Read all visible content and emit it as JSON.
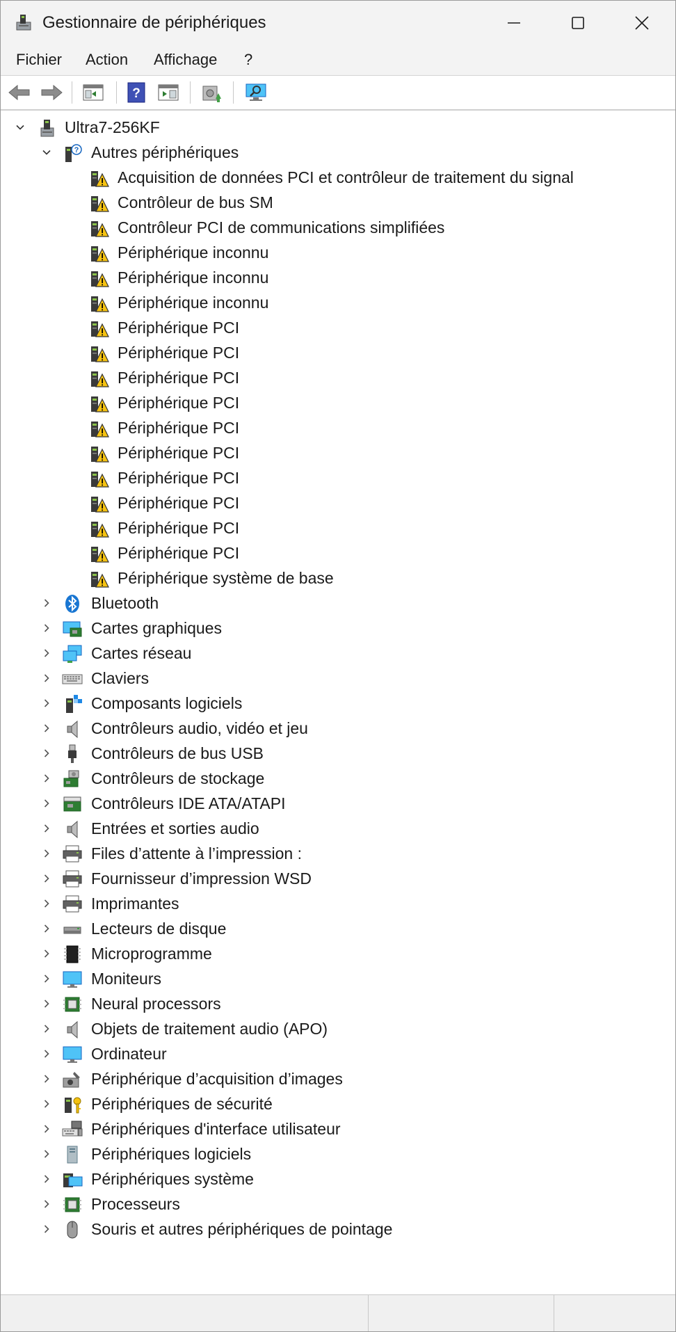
{
  "window": {
    "title": "Gestionnaire de périphériques"
  },
  "menu": [
    "Fichier",
    "Action",
    "Affichage",
    "?"
  ],
  "toolbar": {
    "buttons": [
      "back-icon",
      "forward-icon",
      "properties-pane-icon",
      "help-icon",
      "run-icon",
      "update-driver-icon",
      "scan-hardware-icon"
    ]
  },
  "tree": {
    "root": {
      "label": "Ultra7-256KF",
      "expanded": true,
      "icon": "computer-icon"
    },
    "expanded_category": {
      "label": "Autres périphériques",
      "icon": "unknown-device-icon",
      "children": [
        "Acquisition de données PCI et contrôleur de traitement du signal",
        "Contrôleur de bus SM",
        "Contrôleur PCI de communications simplifiées",
        "Périphérique inconnu",
        "Périphérique inconnu",
        "Périphérique inconnu",
        "Périphérique PCI",
        "Périphérique PCI",
        "Périphérique PCI",
        "Périphérique PCI",
        "Périphérique PCI",
        "Périphérique PCI",
        "Périphérique PCI",
        "Périphérique PCI",
        "Périphérique PCI",
        "Périphérique PCI",
        "Périphérique système de base"
      ]
    },
    "categories": [
      {
        "label": "Bluetooth",
        "icon": "bluetooth-icon"
      },
      {
        "label": "Cartes graphiques",
        "icon": "display-adapter-icon"
      },
      {
        "label": "Cartes réseau",
        "icon": "network-adapter-icon"
      },
      {
        "label": "Claviers",
        "icon": "keyboard-icon"
      },
      {
        "label": "Composants logiciels",
        "icon": "software-component-icon"
      },
      {
        "label": "Contrôleurs audio, vidéo et jeu",
        "icon": "speaker-icon"
      },
      {
        "label": "Contrôleurs de bus USB",
        "icon": "usb-icon"
      },
      {
        "label": "Contrôleurs de stockage",
        "icon": "storage-controller-icon"
      },
      {
        "label": "Contrôleurs IDE ATA/ATAPI",
        "icon": "ide-controller-icon"
      },
      {
        "label": "Entrées et sorties audio",
        "icon": "speaker-icon"
      },
      {
        "label": "Files d’attente à l’impression :",
        "icon": "printer-icon"
      },
      {
        "label": "Fournisseur d’impression WSD",
        "icon": "printer-icon"
      },
      {
        "label": "Imprimantes",
        "icon": "printer-icon"
      },
      {
        "label": "Lecteurs de disque",
        "icon": "disk-drive-icon"
      },
      {
        "label": "Microprogramme",
        "icon": "firmware-icon"
      },
      {
        "label": "Moniteurs",
        "icon": "monitor-icon"
      },
      {
        "label": "Neural processors",
        "icon": "chip-icon"
      },
      {
        "label": "Objets de traitement audio (APO)",
        "icon": "speaker-icon"
      },
      {
        "label": "Ordinateur",
        "icon": "monitor-icon"
      },
      {
        "label": "Périphérique d’acquisition d’images",
        "icon": "camera-icon"
      },
      {
        "label": "Périphériques de sécurité",
        "icon": "security-key-icon"
      },
      {
        "label": "Périphériques d'interface utilisateur",
        "icon": "hid-icon"
      },
      {
        "label": "Périphériques logiciels",
        "icon": "software-device-icon"
      },
      {
        "label": "Périphériques système",
        "icon": "system-device-icon"
      },
      {
        "label": "Processeurs",
        "icon": "chip-icon"
      },
      {
        "label": "Souris et autres périphériques de pointage",
        "icon": "mouse-icon"
      }
    ]
  },
  "colors": {
    "titlebar_bg": "#f3f3f3",
    "warning_yellow": "#f5c211",
    "bluetooth_blue": "#1976d2"
  }
}
